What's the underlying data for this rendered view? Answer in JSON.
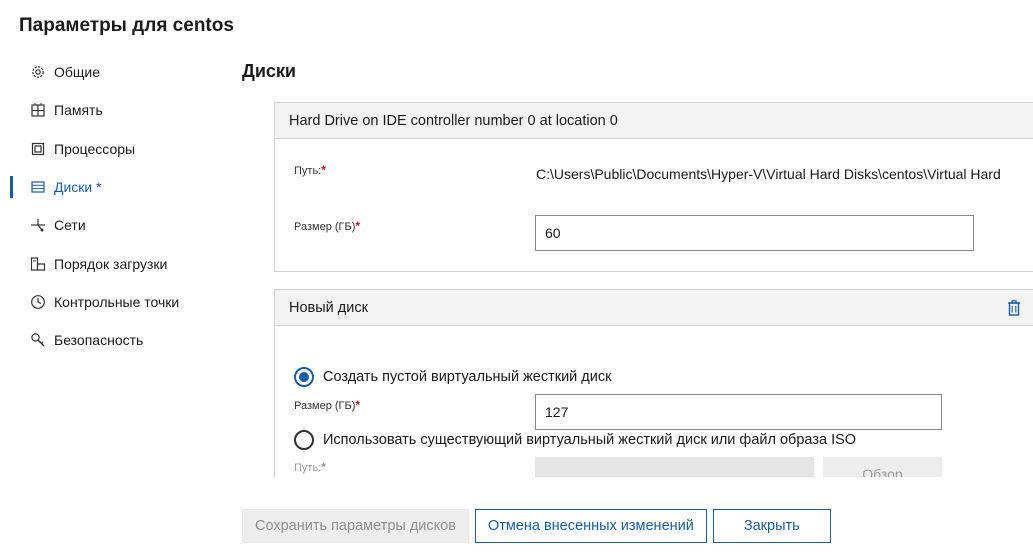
{
  "window": {
    "title": "Параметры для centos"
  },
  "nav": {
    "items": [
      {
        "label": "Общие",
        "icon": "gear-icon"
      },
      {
        "label": "Память",
        "icon": "memory-icon"
      },
      {
        "label": "Процессоры",
        "icon": "processor-icon"
      },
      {
        "label": "Диски *",
        "icon": "disk-icon",
        "active": true
      },
      {
        "label": "Сети",
        "icon": "network-icon"
      },
      {
        "label": "Порядок загрузки",
        "icon": "boot-order-icon"
      },
      {
        "label": "Контрольные точки",
        "icon": "clock-icon"
      },
      {
        "label": "Безопасность",
        "icon": "key-icon"
      }
    ]
  },
  "section": {
    "title": "Диски"
  },
  "hard_drive": {
    "header": "Hard Drive on IDE controller number 0 at location 0",
    "path_label": "Путь:",
    "path_value": "C:\\Users\\Public\\Documents\\Hyper-V\\Virtual Hard Disks\\centos\\Virtual Hard",
    "size_label": "Размер (ГБ)",
    "size_value": "60",
    "required_mark": "*"
  },
  "new_disk": {
    "header": "Новый диск",
    "option_create": "Создать пустой виртуальный жесткий диск",
    "option_create_selected": true,
    "size_label": "Размер (ГБ)",
    "size_value": "127",
    "option_existing": "Использовать существующий виртуальный жесткий диск или файл образа ISO",
    "option_existing_selected": false,
    "path_label": "Путь:",
    "path_value": "",
    "browse_label": "Обзор",
    "required_mark": "*"
  },
  "footer": {
    "save_label": "Сохранить параметры дисков",
    "cancel_label": "Отмена внесенных изменений",
    "close_label": "Закрыть"
  },
  "colors": {
    "accent": "#1a5ea8",
    "required": "#c50f1f",
    "header_bg": "#f3f3f3"
  }
}
